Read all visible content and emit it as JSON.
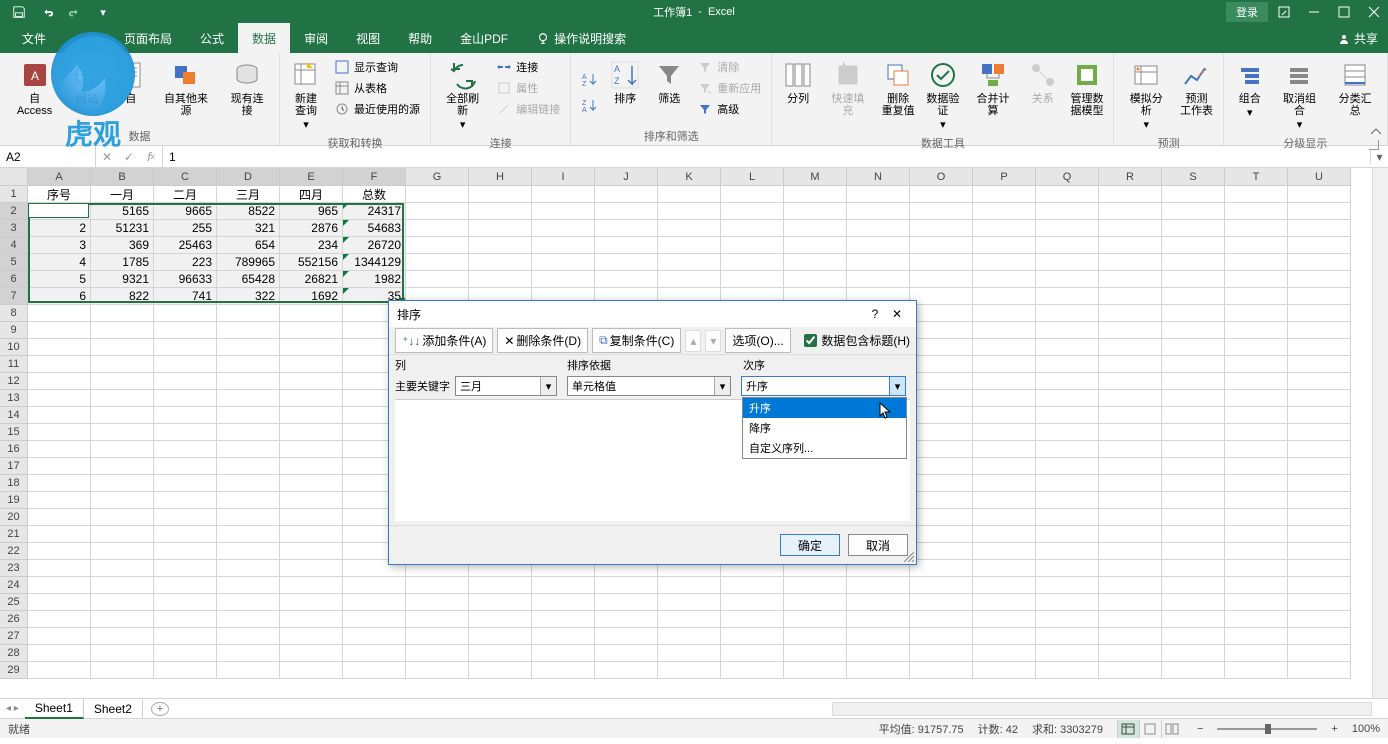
{
  "titlebar": {
    "doc": "工作簿1",
    "app": "Excel",
    "login": "登录"
  },
  "tabs": {
    "file": "文件",
    "insert": "",
    "layout": "页面布局",
    "formulas": "公式",
    "data": "数据",
    "review": "审阅",
    "view": "视图",
    "help": "帮助",
    "pdf": "金山PDF",
    "tell": "操作说明搜索",
    "share": "共享"
  },
  "ribbon": {
    "g_external": {
      "access": "自 Access",
      "web": "网站",
      "text": "自",
      "other": "自其他来源",
      "existing": "现有连接",
      "label": "数据"
    },
    "g_transform": {
      "new_query": "新建\n查询",
      "show_queries": "显示查询",
      "from_table": "从表格",
      "recent": "最近使用的源",
      "label": "获取和转换"
    },
    "g_conn": {
      "refresh": "全部刷新",
      "connections": "连接",
      "properties": "属性",
      "edit_links": "编辑链接",
      "label": "连接"
    },
    "g_sort": {
      "sort_asc": "",
      "sort_desc": "",
      "sort": "排序",
      "filter": "筛选",
      "clear": "清除",
      "reapply": "重新应用",
      "advanced": "高级",
      "label": "排序和筛选"
    },
    "g_tools": {
      "text_to_col": "分列",
      "flash_fill": "快速填充",
      "remove_dup": "删除\n重复值",
      "data_val": "数据验\n证",
      "consolidate": "合并计算",
      "relationships": "关系",
      "data_model": "管理数\n据模型",
      "label": "数据工具"
    },
    "g_forecast": {
      "what_if": "模拟分析",
      "forecast": "预测\n工作表",
      "label": "预测"
    },
    "g_outline": {
      "group": "组合",
      "ungroup": "取消组合",
      "subtotal": "分类汇总",
      "label": "分级显示"
    }
  },
  "fbar": {
    "name": "A2",
    "formula": "1"
  },
  "grid": {
    "cols": [
      "A",
      "B",
      "C",
      "D",
      "E",
      "F",
      "G",
      "H",
      "I",
      "J",
      "K",
      "L",
      "M",
      "N",
      "O",
      "P",
      "Q",
      "R",
      "S",
      "T",
      "U"
    ],
    "rows_shown": 29,
    "headers": [
      "序号",
      "一月",
      "二月",
      "三月",
      "四月",
      "总数"
    ],
    "data": [
      [
        1,
        5165,
        9665,
        8522,
        965,
        24317
      ],
      [
        2,
        51231,
        255,
        321,
        2876,
        54683
      ],
      [
        3,
        369,
        25463,
        654,
        234,
        26720
      ],
      [
        4,
        1785,
        223,
        789965,
        552156,
        1344129
      ],
      [
        5,
        9321,
        96633,
        65428,
        26821,
        "1982"
      ],
      [
        6,
        822,
        741,
        322,
        1692,
        "35"
      ]
    ]
  },
  "sheets": {
    "s1": "Sheet1",
    "s2": "Sheet2"
  },
  "statusbar": {
    "ready": "就绪",
    "avg_lbl": "平均值:",
    "avg": "91757.75",
    "count_lbl": "计数:",
    "count": "42",
    "sum_lbl": "求和:",
    "sum": "3303279",
    "zoom": "100%"
  },
  "dialog": {
    "title": "排序",
    "add": "添加条件(A)",
    "delete": "删除条件(D)",
    "copy": "复制条件(C)",
    "options": "选项(O)...",
    "has_header": "数据包含标题(H)",
    "col_h": "列",
    "key_h": "排序依据",
    "order_h": "次序",
    "primary": "主要关键字",
    "sel_col": "三月",
    "sel_key": "单元格值",
    "sel_order": "升序",
    "dd_asc": "升序",
    "dd_desc": "降序",
    "dd_custom": "自定义序列...",
    "ok": "确定",
    "cancel": "取消"
  },
  "chart_data": {
    "type": "table",
    "title": "",
    "columns": [
      "序号",
      "一月",
      "二月",
      "三月",
      "四月",
      "总数"
    ],
    "rows": [
      [
        1,
        5165,
        9665,
        8522,
        965,
        24317
      ],
      [
        2,
        51231,
        255,
        321,
        2876,
        54683
      ],
      [
        3,
        369,
        25463,
        654,
        234,
        26720
      ],
      [
        4,
        1785,
        223,
        789965,
        552156,
        1344129
      ],
      [
        5,
        9321,
        96633,
        65428,
        26821,
        null
      ],
      [
        6,
        822,
        741,
        322,
        1692,
        null
      ]
    ]
  }
}
